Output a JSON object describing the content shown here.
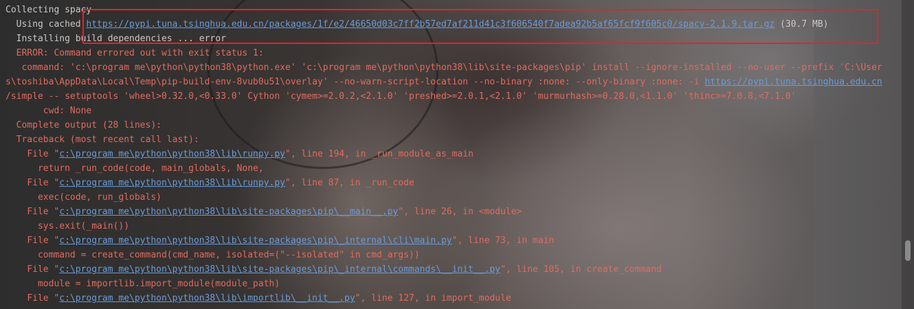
{
  "terminal": {
    "lines": [
      {
        "indent": "",
        "parts": [
          {
            "t": "Collecting spacy",
            "c": "gray"
          }
        ]
      },
      {
        "indent": "  ",
        "parts": [
          {
            "t": "Using cached ",
            "c": "gray"
          },
          {
            "t": "https://pypi.tuna.tsinghua.edu.cn/packages/1f/e2/46650d03c7ff2b57ed7af211d41c3f606540f7adea92b5af65fcf9f605c0/spacy-2.1.9.tar.gz",
            "c": "link"
          },
          {
            "t": " (30.7 MB)",
            "c": "gray"
          }
        ]
      },
      {
        "indent": "  ",
        "parts": [
          {
            "t": "Installing build dependencies ... error",
            "c": "gray"
          }
        ]
      },
      {
        "indent": "  ",
        "parts": [
          {
            "t": "ERROR: Command errored out with exit status 1:",
            "c": "red"
          }
        ]
      },
      {
        "indent": "   ",
        "parts": [
          {
            "t": "command: 'c:\\program me\\python\\python38\\python.exe' 'c:\\program me\\python\\python38\\lib\\site-packages\\pip' install --ignore-installed --no-user --prefix 'C:\\User",
            "c": "red"
          }
        ]
      },
      {
        "indent": "",
        "parts": [
          {
            "t": "s\\toshiba\\AppData\\Local\\Temp\\pip-build-env-8vub0u51\\overlay' --no-warn-script-location --no-binary :none: --only-binary :none: -i ",
            "c": "red"
          },
          {
            "t": "https://pypi.tuna.tsinghua.edu.cn",
            "c": "link"
          }
        ]
      },
      {
        "indent": "",
        "parts": [
          {
            "t": "/simple -- setuptools 'wheel>0.32.0,<0.33.0' Cython 'cymem>=2.0.2,<2.1.0' 'preshed>=2.0.1,<2.1.0' 'murmurhash>=0.28.0,<1.1.0' 'thinc>=7.0.8,<7.1.0'",
            "c": "red"
          }
        ]
      },
      {
        "indent": "       ",
        "parts": [
          {
            "t": "cwd: None",
            "c": "red"
          }
        ]
      },
      {
        "indent": "  ",
        "parts": [
          {
            "t": "Complete output (28 lines):",
            "c": "red"
          }
        ]
      },
      {
        "indent": "  ",
        "parts": [
          {
            "t": "Traceback (most recent call last):",
            "c": "red"
          }
        ]
      },
      {
        "indent": "    ",
        "parts": [
          {
            "t": "File \"",
            "c": "red"
          },
          {
            "t": "c:\\program me\\python\\python38\\lib\\runpy.py",
            "c": "link"
          },
          {
            "t": "\", line 194, in _run_module_as_main",
            "c": "red"
          }
        ]
      },
      {
        "indent": "      ",
        "parts": [
          {
            "t": "return _run_code(code, main_globals, None,",
            "c": "red"
          }
        ]
      },
      {
        "indent": "    ",
        "parts": [
          {
            "t": "File \"",
            "c": "red"
          },
          {
            "t": "c:\\program me\\python\\python38\\lib\\runpy.py",
            "c": "link"
          },
          {
            "t": "\", line 87, in _run_code",
            "c": "red"
          }
        ]
      },
      {
        "indent": "      ",
        "parts": [
          {
            "t": "exec(code, run_globals)",
            "c": "red"
          }
        ]
      },
      {
        "indent": "    ",
        "parts": [
          {
            "t": "File \"",
            "c": "red"
          },
          {
            "t": "c:\\program me\\python\\python38\\lib\\site-packages\\pip\\__main__.py",
            "c": "link"
          },
          {
            "t": "\", line 26, in <module>",
            "c": "red"
          }
        ]
      },
      {
        "indent": "      ",
        "parts": [
          {
            "t": "sys.exit(_main())",
            "c": "red"
          }
        ]
      },
      {
        "indent": "    ",
        "parts": [
          {
            "t": "File \"",
            "c": "red"
          },
          {
            "t": "c:\\program me\\python\\python38\\lib\\site-packages\\pip\\_internal\\cli\\main.py",
            "c": "link"
          },
          {
            "t": "\", line 73, in main",
            "c": "red"
          }
        ]
      },
      {
        "indent": "      ",
        "parts": [
          {
            "t": "command = create_command(cmd_name, isolated=(\"--isolated\" in cmd_args))",
            "c": "red"
          }
        ]
      },
      {
        "indent": "    ",
        "parts": [
          {
            "t": "File \"",
            "c": "red"
          },
          {
            "t": "c:\\program me\\python\\python38\\lib\\site-packages\\pip\\_internal\\commands\\__init__.py",
            "c": "link"
          },
          {
            "t": "\", line 105, in create_command",
            "c": "red"
          }
        ]
      },
      {
        "indent": "      ",
        "parts": [
          {
            "t": "module = importlib.import_module(module_path)",
            "c": "red"
          }
        ]
      },
      {
        "indent": "    ",
        "parts": [
          {
            "t": "File \"",
            "c": "red"
          },
          {
            "t": "c:\\program me\\python\\python38\\lib\\importlib\\__init__.py",
            "c": "link"
          },
          {
            "t": "\", line 127, in import_module",
            "c": "red"
          }
        ]
      }
    ]
  },
  "colors": {
    "text_gray": "#c8c8c8",
    "text_red": "#e06b5f",
    "link": "#6a9bd8",
    "highlight_box": "#e8202a",
    "background": "#2b2b2b"
  }
}
